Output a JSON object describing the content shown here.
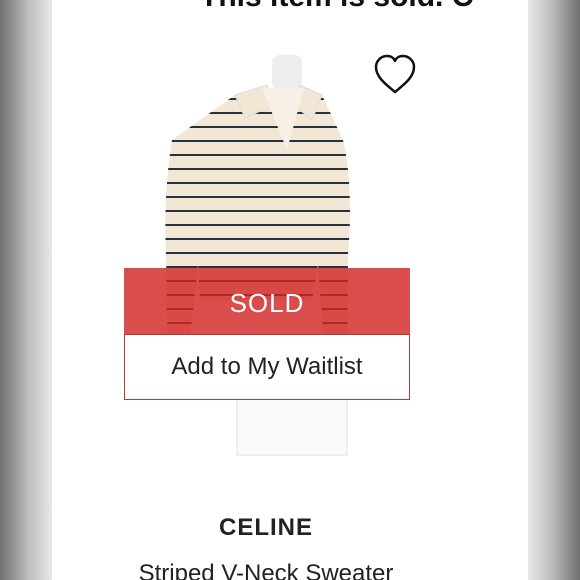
{
  "banner": {
    "text": "This item is sold. C"
  },
  "listing": {
    "status_label": "SOLD",
    "waitlist_button_label": "Add to My Waitlist",
    "brand": "CELINE",
    "product_name": "Striped V-Neck Sweater",
    "favorite_icon": "heart-outline-icon"
  },
  "colors": {
    "sold_overlay": "#d22626",
    "waitlist_border": "#b33a36",
    "text": "#222222"
  }
}
